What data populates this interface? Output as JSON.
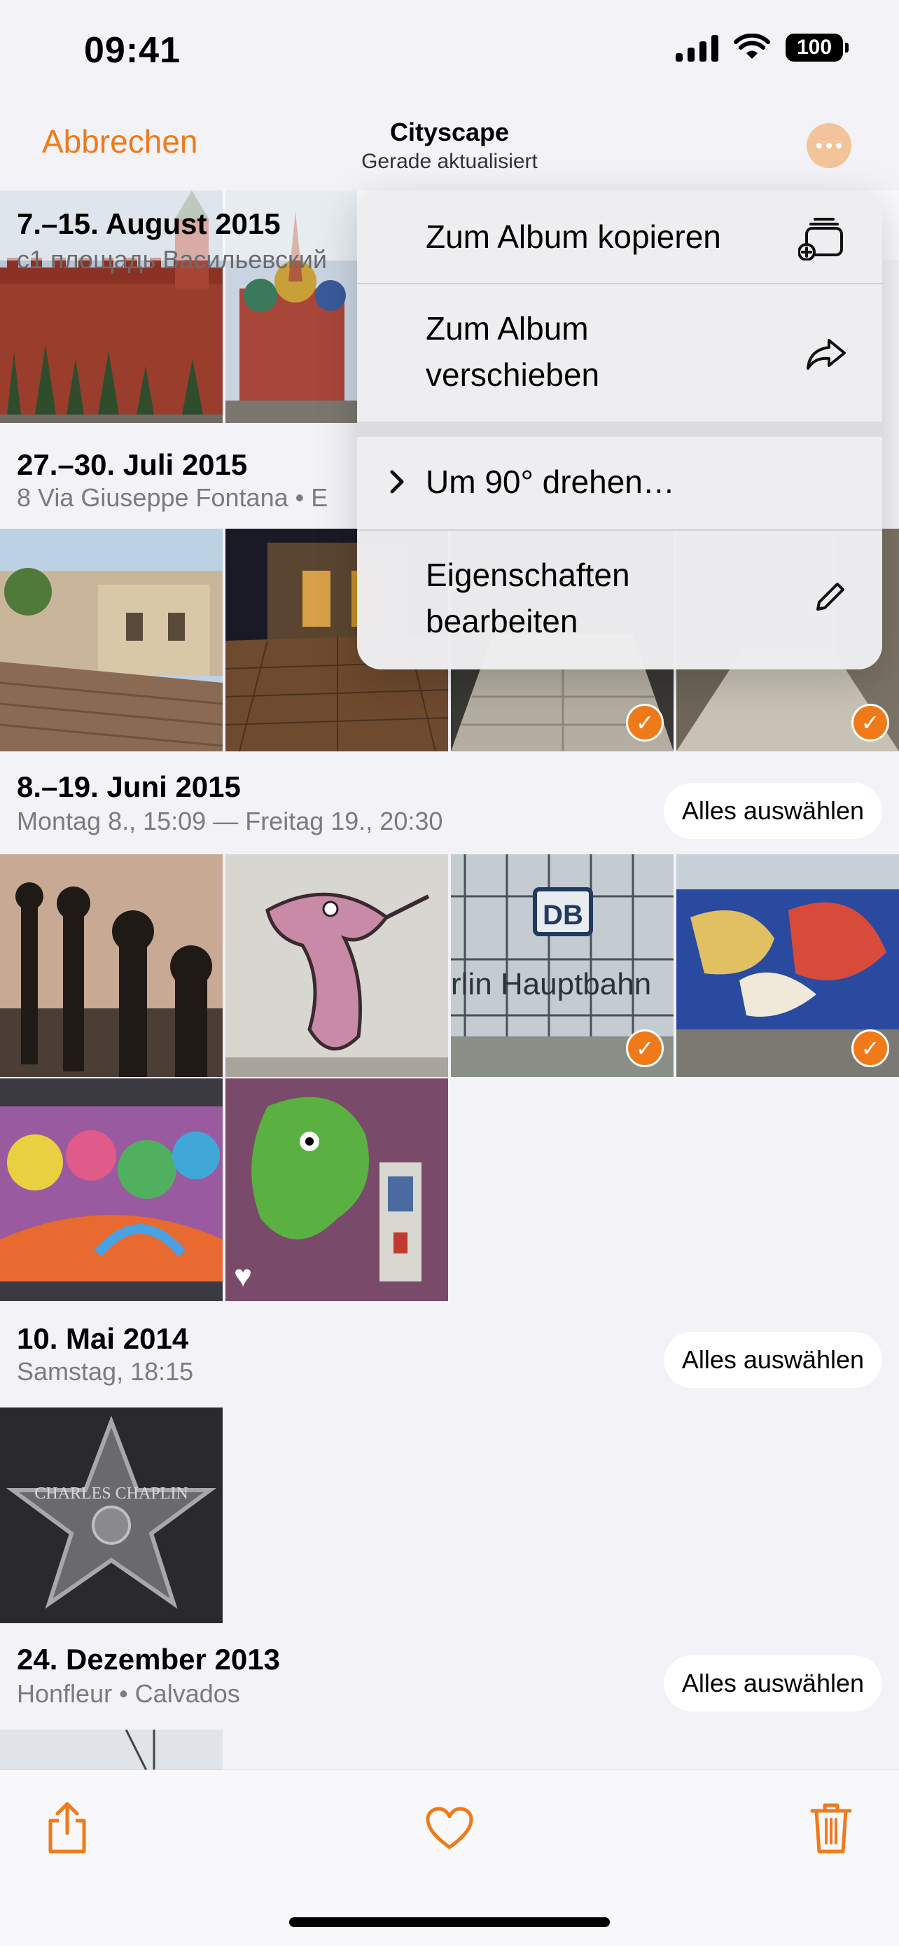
{
  "status": {
    "time": "09:41",
    "battery": "100"
  },
  "nav": {
    "cancel": "Abbrechen",
    "title": "Cityscape",
    "subtitle": "Gerade aktualisiert"
  },
  "menu": {
    "items": [
      {
        "label": "Zum Album kopieren",
        "icon": "album-copy-icon"
      },
      {
        "label": "Zum Album verschieben",
        "icon": "share-arrow-icon"
      },
      {
        "label": "Um 90° drehen…",
        "icon": "chevron-right-icon"
      },
      {
        "label": "Eigenschaften bearbeiten",
        "icon": "pencil-icon"
      }
    ]
  },
  "sections": [
    {
      "title": "7.–15. August 2015",
      "subtitle": "с1 площадь Васильевский"
    },
    {
      "title": "27.–30. Juli 2015",
      "subtitle": "8 Via Giuseppe Fontana • E"
    },
    {
      "title": "8.–19. Juni 2015",
      "subtitle": "Montag 8., 15:09 — Freitag 19., 20:30",
      "select_all": "Alles auswählen"
    },
    {
      "title": "10. Mai 2014",
      "subtitle": "Samstag, 18:15",
      "select_all": "Alles auswählen"
    },
    {
      "title": "24. Dezember 2013",
      "subtitle": "Honfleur • Calvados",
      "select_all": "Alles auswählen"
    }
  ],
  "photo_texts": {
    "db": "DB",
    "station": "rlin Hauptbahn",
    "star": "CHARLES   CHAPLIN"
  },
  "toolbar": {
    "share": "share-icon",
    "favorite": "heart-icon",
    "delete": "trash-icon"
  },
  "colors": {
    "accent": "#f07a1a",
    "background": "#f2f2f7"
  }
}
